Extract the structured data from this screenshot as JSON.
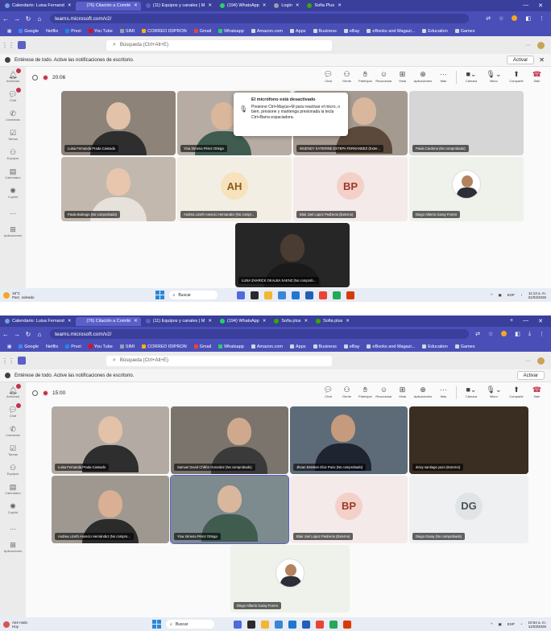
{
  "colors": {
    "chrome_dark": "#3a3f9c",
    "chrome_light": "#4a4fb8",
    "teams_accent": "#5b5fc7",
    "record_red": "#c4314b"
  },
  "browser": {
    "tabs_top": [
      {
        "label": "Calendario: Luisa Fernand",
        "color": "#6fa0e0"
      },
      {
        "label": "(76) Citación a Comité",
        "color": "#5b5fc7"
      },
      {
        "label": "(11) Equipos y canales | M",
        "color": "#5b5fc7"
      },
      {
        "label": "(194) WhatsApp",
        "color": "#25d366"
      },
      {
        "label": "Login",
        "color": "#9aa0a6"
      },
      {
        "label": "Sofia Plus",
        "color": "#39a900"
      }
    ],
    "tabs_bottom": [
      {
        "label": "Calendario: Luisa Fernand",
        "color": "#6fa0e0"
      },
      {
        "label": "(76) Citación a Comité",
        "color": "#5b5fc7"
      },
      {
        "label": "(11) Equipos y canales | M",
        "color": "#5b5fc7"
      },
      {
        "label": "(194) WhatsApp",
        "color": "#25d366"
      },
      {
        "label": "Sofia plus",
        "color": "#39a900"
      },
      {
        "label": "Sofia plus",
        "color": "#39a900"
      }
    ],
    "url": "teams.microsoft.com/v2/",
    "bookmarks": [
      "Google",
      "Netflix",
      "Prezi",
      "You Tube",
      "SIMI",
      "CORREO IDIPRON",
      "Gmail",
      "Whatsapp",
      "Amazon.com",
      "Apps",
      "Business",
      "eBay",
      "eBooks and Magazi...",
      "Education",
      "Games"
    ]
  },
  "teams": {
    "search_placeholder": "Búsqueda (Ctrl+Alt+E)",
    "notification_text": "Entérese de todo. Active las notificaciones de escritorio.",
    "activate_label": "Activar",
    "rail": [
      "Actividad",
      "Chat",
      "Llamadas",
      "Tareas",
      "Equipos",
      "Calendario",
      "Copilot",
      "...",
      "Aplicaciones"
    ],
    "tools": [
      "Chat",
      "Gente",
      "Participar",
      "Reaccionar",
      "Vista",
      "Aplicaciones",
      "Más",
      "Cámara",
      "Micro",
      "Compartir",
      "Salir"
    ]
  },
  "meeting_top": {
    "timer": "20:06",
    "tiles": [
      "Luisa Fernanda Prada Cassado",
      "Yina Ximena Pérez Ortega",
      "WUENDY KATERINE ESTEPA FERNANDEZ (Exter...",
      "Paula Cardona (No comprobado)",
      "Paula Buitrago (No comprobado)",
      "Andrea Lizeth Asencio Hernandez (No compr...",
      "Blair Joel Lopez Pedreros (Externo)",
      "Diego Alberto Garay Forero",
      "LUNA ZHARICK OKALBA SAENZ (No comprob..."
    ],
    "initials": [
      "AH",
      "BP"
    ],
    "tooltip": {
      "title": "El micrófono está desactivado",
      "body": "Presione Ctrl+Mayús+M para reactivar el micro, o bien, presione y mantenga presionada la tecla Ctrl+Barra espaciadora."
    }
  },
  "meeting_bottom": {
    "timer": "15:00",
    "tiles": [
      "Luisa Fernanda Prada Cassado",
      "Samuel David Chillón Gonzalez (No comprobado)",
      "Jhoan Esteban Díaz Pazo (No comprobado)",
      "deivy santiago yazo (Externo)",
      "Andrea Lizeth Asencio Hernández (No compro...",
      "Yina Ximena Pérez Ortega",
      "Blair Joel Lopez Pedreros (Externo)",
      "Diego Garay (No comprobado)",
      "Diego Alberto Garay Forero"
    ],
    "initials": [
      "BP",
      "DG"
    ]
  },
  "taskbar_top": {
    "weather_temp": "18°C",
    "weather_desc": "Parc. soleado",
    "search": "Buscar",
    "lang": "ESP",
    "time": "11:13 a. m.",
    "date": "31/03/2025"
  },
  "taskbar_bottom": {
    "weather_temp": "Aire malo",
    "weather_desc": "Hoy",
    "search": "Buscar",
    "lang": "ESP",
    "time": "10:54 a. m.",
    "date": "11/03/2025"
  }
}
